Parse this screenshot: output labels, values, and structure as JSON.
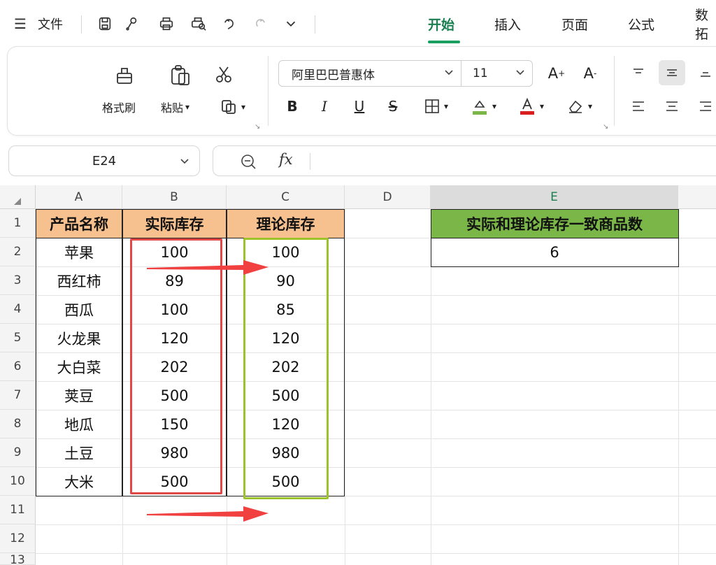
{
  "app": {
    "file_menu": "文件",
    "tabs": [
      {
        "label": "开始",
        "active": true
      },
      {
        "label": "插入",
        "active": false
      },
      {
        "label": "页面",
        "active": false
      },
      {
        "label": "公式",
        "active": false
      },
      {
        "label": "数拓",
        "active": false
      }
    ],
    "accent_color": "#1a9f60"
  },
  "ribbon": {
    "format_painter": "格式刷",
    "paste": "粘贴",
    "font_name": "阿里巴巴普惠体",
    "font_size": "11",
    "bold": "B",
    "italic": "I",
    "underline": "U",
    "strike": "S",
    "increase_font": "A",
    "decrease_font": "A"
  },
  "formula_bar": {
    "cell_ref": "E24",
    "fx": "fx",
    "content": ""
  },
  "sheet": {
    "columns": [
      "A",
      "B",
      "C",
      "D",
      "E"
    ],
    "selected_column": "E",
    "rows": [
      "1",
      "2",
      "3",
      "4",
      "5",
      "6",
      "7",
      "8",
      "9",
      "10",
      "11",
      "12",
      "13"
    ],
    "table_headers": [
      "产品名称",
      "实际库存",
      "理论库存"
    ],
    "table_rows": [
      {
        "name": "苹果",
        "actual": "100",
        "theory": "100"
      },
      {
        "name": "西红柿",
        "actual": "89",
        "theory": "90"
      },
      {
        "name": "西瓜",
        "actual": "100",
        "theory": "85"
      },
      {
        "name": "火龙果",
        "actual": "120",
        "theory": "120"
      },
      {
        "name": "大白菜",
        "actual": "202",
        "theory": "202"
      },
      {
        "name": "荚豆",
        "actual": "500",
        "theory": "500"
      },
      {
        "name": "地瓜",
        "actual": "150",
        "theory": "120"
      },
      {
        "name": "土豆",
        "actual": "980",
        "theory": "980"
      },
      {
        "name": "大米",
        "actual": "500",
        "theory": "500"
      }
    ],
    "result_header": "实际和理论库存一致商品数",
    "result_value": "6",
    "colors": {
      "header_orange": "#f7c08f",
      "header_green": "#7ab648",
      "highlight_red": "#e04848",
      "highlight_green": "#9cc42a"
    }
  }
}
